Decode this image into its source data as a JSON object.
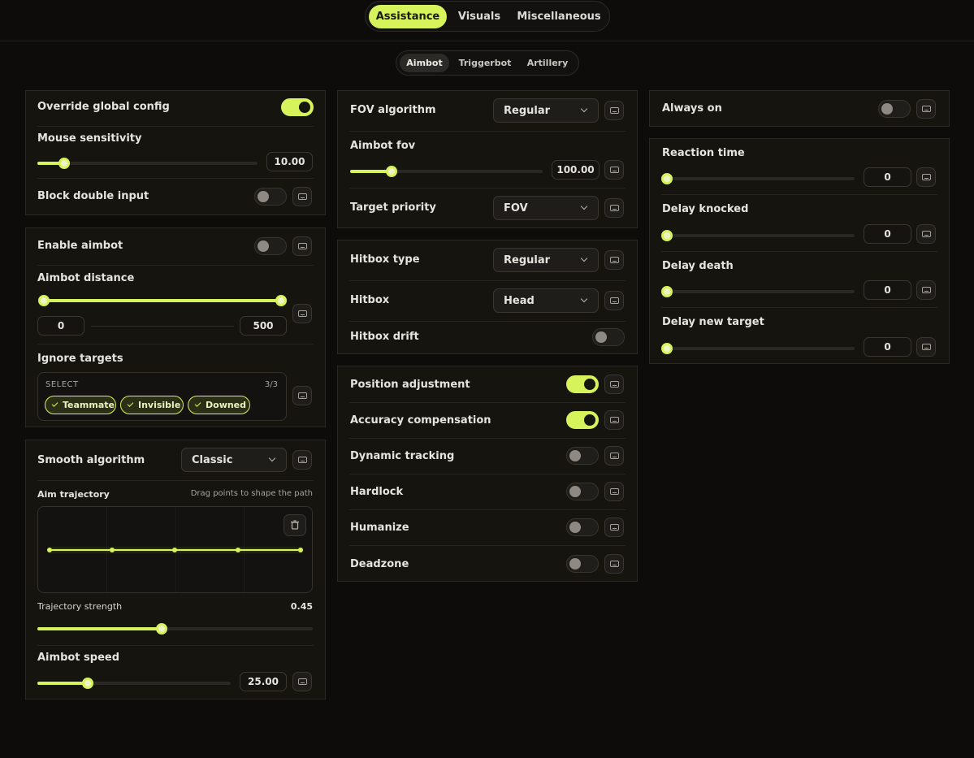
{
  "main_tabs": [
    {
      "label": "Assistance",
      "active": true
    },
    {
      "label": "Visuals",
      "active": false
    },
    {
      "label": "Miscellaneous",
      "active": false
    }
  ],
  "sub_tabs": [
    {
      "label": "Aimbot",
      "active": true
    },
    {
      "label": "Triggerbot",
      "active": false
    },
    {
      "label": "Artillery",
      "active": false
    }
  ],
  "accent_color": "#d6f35c",
  "left": {
    "general": {
      "override_label": "Override global config",
      "override_on": true,
      "sensitivity_label": "Mouse sensitivity",
      "sensitivity_value": "10.00",
      "sensitivity_fraction": 0.12,
      "block_label": "Block double input",
      "block_on": false
    },
    "aimbot": {
      "enable_label": "Enable aimbot",
      "enable_on": false,
      "distance_label": "Aimbot distance",
      "distance_min": "0",
      "distance_max": "500",
      "ignore_label": "Ignore targets",
      "select_label": "SELECT",
      "select_count": "3/3",
      "targets": [
        "Teammate",
        "Invisible",
        "Downed"
      ]
    },
    "smooth": {
      "algorithm_label": "Smooth algorithm",
      "algorithm_value": "Classic",
      "trajectory_label": "Aim trajectory",
      "trajectory_hint": "Drag points to shape the path",
      "strength_label": "Trajectory strength",
      "strength_value": "0.45",
      "strength_fraction": 0.45,
      "speed_label": "Aimbot speed",
      "speed_value": "25.00",
      "speed_fraction": 0.25
    }
  },
  "middle": {
    "fov": {
      "algorithm_label": "FOV algorithm",
      "algorithm_value": "Regular",
      "fov_label": "Aimbot fov",
      "fov_value": "100.00",
      "fov_fraction": 0.22,
      "priority_label": "Target priority",
      "priority_value": "FOV"
    },
    "hitbox": {
      "type_label": "Hitbox type",
      "type_value": "Regular",
      "hitbox_label": "Hitbox",
      "hitbox_value": "Head",
      "drift_label": "Hitbox drift",
      "drift_on": false
    },
    "adjust": [
      {
        "label": "Position adjustment",
        "on": true
      },
      {
        "label": "Accuracy compensation",
        "on": true
      },
      {
        "label": "Dynamic tracking",
        "on": false
      },
      {
        "label": "Hardlock",
        "on": false
      },
      {
        "label": "Humanize",
        "on": false
      },
      {
        "label": "Deadzone",
        "on": false
      }
    ]
  },
  "right": {
    "always_label": "Always on",
    "always_on": false,
    "delays": [
      {
        "label": "Reaction time",
        "value": "0"
      },
      {
        "label": "Delay knocked",
        "value": "0"
      },
      {
        "label": "Delay death",
        "value": "0"
      },
      {
        "label": "Delay new target",
        "value": "0"
      }
    ]
  }
}
